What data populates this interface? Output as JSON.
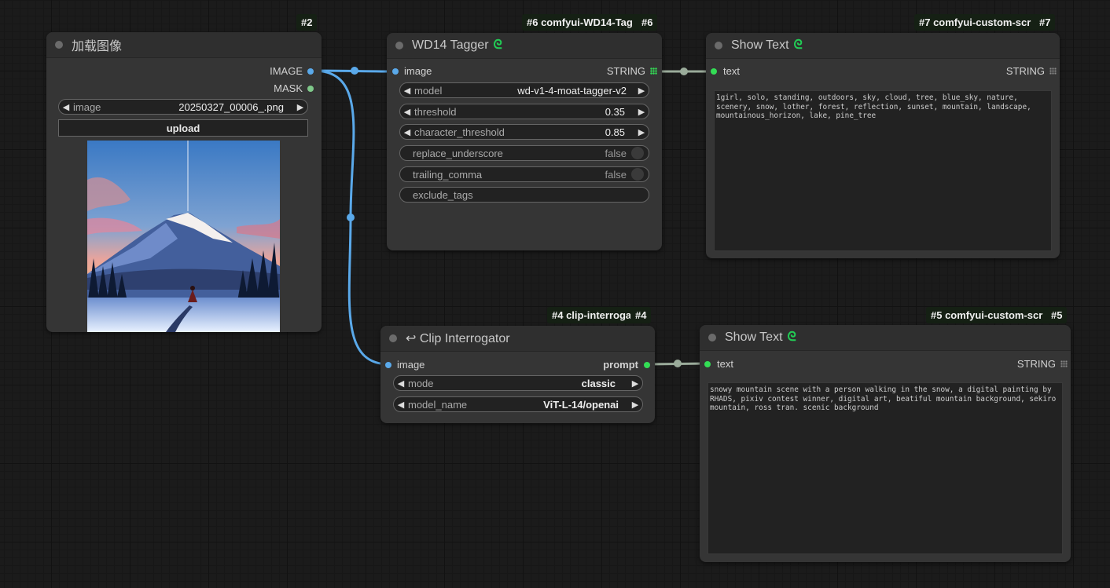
{
  "colors": {
    "link_image": "#5aa9ea",
    "link_string": "#9aab9a",
    "slot_image": "#5aa9ea",
    "slot_mask": "#7fc98a",
    "slot_string": "#33dd55",
    "logo": "#22cc55"
  },
  "node2": {
    "badge": "#2",
    "title": "加载图像",
    "out_image": "IMAGE",
    "out_mask": "MASK",
    "image_label": "image",
    "image_value": "20250327_00006_.png",
    "upload_label": "upload",
    "preview_icon": "snowy-mountain-landscape-image"
  },
  "node6": {
    "badge": "#6 comfyui-WD14-Tag",
    "badge_id": "#6",
    "title": "WD14 Tagger",
    "in_image": "image",
    "out_string": "STRING",
    "widgets": [
      {
        "label": "model",
        "value": "wd-v1-4-moat-tagger-v2"
      },
      {
        "label": "threshold",
        "value": "0.35"
      },
      {
        "label": "character_threshold",
        "value": "0.85"
      },
      {
        "label": "replace_underscore",
        "value": "false"
      },
      {
        "label": "trailing_comma",
        "value": "false"
      },
      {
        "label": "exclude_tags",
        "value": ""
      }
    ]
  },
  "node7": {
    "badge": "#7 comfyui-custom-scr",
    "badge_id": "#7",
    "title": "Show Text",
    "in_text": "text",
    "out_string": "STRING",
    "text": "1girl, solo, standing, outdoors, sky, cloud, tree, blue_sky, nature, scenery, snow, lother, forest, reflection, sunset, mountain, landscape, mountainous_horizon, lake, pine_tree"
  },
  "node4": {
    "badge": "#4 clip-interroga",
    "badge_id": "#4",
    "title": "↩ Clip Interrogator",
    "in_image": "image",
    "out_prompt": "prompt",
    "widgets": [
      {
        "label": "mode",
        "value": "classic"
      },
      {
        "label": "model_name",
        "value": "ViT-L-14/openai"
      }
    ]
  },
  "node5": {
    "badge": "#5 comfyui-custom-scr",
    "badge_id": "#5",
    "title": "Show Text",
    "in_text": "text",
    "out_string": "STRING",
    "text": "snowy mountain scene with a person walking in the snow, a digital painting by RHADS, pixiv contest winner, digital art, beatiful mountain background, sekiro mountain, ross tran. scenic background"
  }
}
